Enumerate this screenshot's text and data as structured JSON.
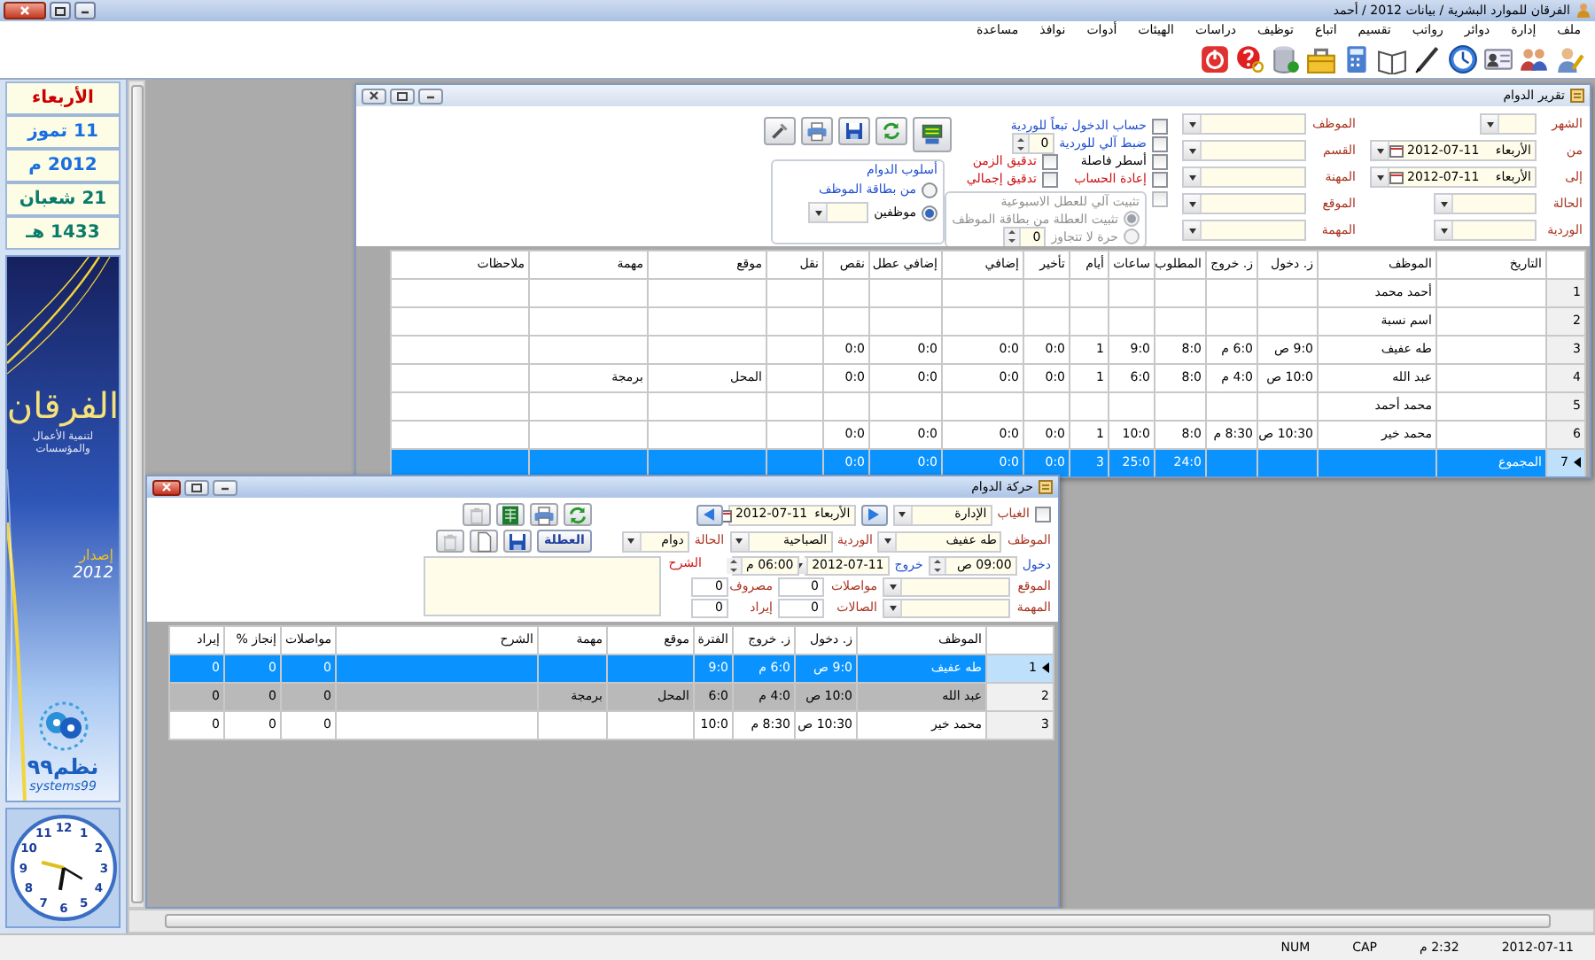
{
  "window": {
    "title": "الفرقان للموارد البشرية / بيانات 2012 / أحمد"
  },
  "menu": [
    {
      "label": "ملف"
    },
    {
      "label": "إدارة"
    },
    {
      "label": "دوائر"
    },
    {
      "label": "رواتب"
    },
    {
      "label": "تقسيم"
    },
    {
      "label": "اتباع"
    },
    {
      "label": "توظيف"
    },
    {
      "label": "دراسات"
    },
    {
      "label": "الهيئات"
    },
    {
      "label": "أدوات"
    },
    {
      "label": "نوافذ"
    },
    {
      "label": "مساعدة"
    }
  ],
  "sidebar": {
    "dates": [
      {
        "kind": "day",
        "text": "الأربعاء"
      },
      {
        "kind": "gregorian",
        "text": "11 تموز"
      },
      {
        "kind": "gregorian",
        "text": "2012 م"
      },
      {
        "kind": "hijri",
        "text": "21 شعبان"
      },
      {
        "kind": "hijri",
        "text": "1433 هـ"
      }
    ],
    "banner": {
      "title": "الفرقان",
      "subtitle": "لتنمية الأعمال والمؤسسات",
      "edition_label": "إصدار",
      "edition_year": "2012",
      "brand": "نظم٩٩",
      "brand_latin": "systems99"
    },
    "clock": {
      "numerals": [
        "12",
        "1",
        "11",
        "2",
        "10",
        "3",
        "9",
        "4",
        "8",
        "5",
        "7",
        "6"
      ]
    }
  },
  "report_window": {
    "title": "تقرير الدوام",
    "active": false,
    "period": [
      {
        "label": "الشهر",
        "kind": "dropdown"
      },
      {
        "label": "من",
        "kind": "date",
        "weekday": "الأربعاء",
        "date": "2012-07-11"
      },
      {
        "label": "إلى",
        "kind": "date",
        "weekday": "الأربعاء",
        "date": "2012-07-11"
      },
      {
        "label": "الحالة",
        "kind": "dropdown"
      },
      {
        "label": "الوردية",
        "kind": "dropdown"
      }
    ],
    "filters": [
      {
        "label": "الموظف"
      },
      {
        "label": "القسم"
      },
      {
        "label": "المهنة"
      },
      {
        "label": "الموقع"
      },
      {
        "label": "المهمة"
      }
    ],
    "options": [
      {
        "label": "حساب الدخول تبعاً للوردية",
        "checked": false,
        "color": "#1f4fd0"
      },
      {
        "label": "ضبط آلي للوردية",
        "checked": false,
        "color": "#1f4fd0",
        "spinner": "0"
      },
      {
        "label": "أسطر فاصلة",
        "checked": false,
        "color": "#000000"
      },
      {
        "label": "إعادة الحساب",
        "checked": false,
        "color": "#d01010"
      }
    ],
    "audits": [
      {
        "label": "تدقيق الزمن",
        "checked": false
      },
      {
        "label": "تدقيق إجمالي",
        "checked": false
      }
    ],
    "weekend": {
      "label": "تثبيت آلي للعطل الاسبوعية",
      "checked": false,
      "disabled": true,
      "choices": [
        {
          "label": "تثبيت العطلة من بطاقة الموظف",
          "selected": true
        },
        {
          "label": "حرة لا تتجاوز",
          "selected": false,
          "spinner": "0"
        }
      ]
    },
    "attendance_mode": {
      "title": "أسلوب الدوام",
      "choices": [
        {
          "label": "من بطاقة الموظف",
          "selected": false
        },
        {
          "label": "موظفين",
          "selected": true
        }
      ]
    },
    "table": {
      "columns": [
        "التاريخ",
        "الموظف",
        "ز. دخول",
        "ز. خروج",
        "المطلوب",
        "ساعات",
        "أيام",
        "تأخير",
        "إضافي",
        "إضافي عطل",
        "نقص",
        "نقل",
        "موقع",
        "مهمة",
        "ملاحظات"
      ],
      "rows": [
        {
          "number": "1",
          "selected": false,
          "employee": "أحمد محمد"
        },
        {
          "number": "2",
          "selected": false,
          "employee": "اسم نسبة"
        },
        {
          "number": "3",
          "selected": false,
          "employee": "طه عفيف",
          "in": "9:0 ص",
          "out": "6:0 م",
          "required": "8:0",
          "hours": "9:0",
          "days": "1",
          "late": "0:0",
          "overtime": "0:0",
          "holiday_overtime": "0:0",
          "shortfall": "0:0"
        },
        {
          "number": "4",
          "selected": false,
          "employee": "عبد الله",
          "in": "10:0 ص",
          "out": "4:0 م",
          "required": "8:0",
          "hours": "6:0",
          "days": "1",
          "late": "0:0",
          "overtime": "0:0",
          "holiday_overtime": "0:0",
          "shortfall": "0:0",
          "site": "المحل",
          "task": "برمجة"
        },
        {
          "number": "5",
          "selected": false,
          "employee": "محمد أحمد"
        },
        {
          "number": "6",
          "selected": false,
          "employee": "محمد خير",
          "in": "10:30 ص",
          "out": "8:30 م",
          "required": "8:0",
          "hours": "10:0",
          "days": "1",
          "late": "0:0",
          "overtime": "0:0",
          "holiday_overtime": "0:0",
          "shortfall": "0:0"
        },
        {
          "number": "7",
          "selected": true,
          "date": "المجموع",
          "required": "24:0",
          "hours": "25:0",
          "days": "3",
          "late": "0:0",
          "overtime": "0:0",
          "holiday_overtime": "0:0",
          "shortfall": "0:0"
        }
      ]
    }
  },
  "movement_window": {
    "title": "حركة الدوام",
    "active": true,
    "absence": {
      "label": "الغياب",
      "checked": false
    },
    "department": "الإدارة",
    "date": {
      "weekday": "الأربعاء",
      "date": "2012-07-11"
    },
    "employee": {
      "label": "الموظف",
      "value": "طه عفيف"
    },
    "shift": {
      "label": "الوردية",
      "value": "الصباحية"
    },
    "status": {
      "label": "الحالة",
      "value": "دوام"
    },
    "holiday_button": "العطلة",
    "entry": {
      "label": "دخول",
      "time": "09:00 ص"
    },
    "exit": {
      "label": "خروج",
      "date": "2012-07-11",
      "time": "06:00 م"
    },
    "description": {
      "label": "الشرح"
    },
    "site": {
      "label": "الموقع"
    },
    "task": {
      "label": "المهمة"
    },
    "amounts": [
      {
        "label": "مواصلات",
        "value": "0"
      },
      {
        "label": "مصروف",
        "value": "0"
      },
      {
        "label": "الصالات",
        "value": "0"
      },
      {
        "label": "إيراد",
        "value": "0"
      }
    ],
    "table": {
      "columns": [
        "الموظف",
        "ز. دخول",
        "ز. خروج",
        "الفترة",
        "موقع",
        "مهمة",
        "الشرح",
        "مواصلات",
        "إنجاز %",
        "إيراد"
      ],
      "rows": [
        {
          "number": "1",
          "selected": true,
          "highlighted": false,
          "employee": "طه عفيف",
          "in": "9:0 ص",
          "out": "6:0 م",
          "period": "9:0",
          "transport": "0",
          "completion": "0",
          "revenue": "0"
        },
        {
          "number": "2",
          "selected": false,
          "highlighted": true,
          "employee": "عبد الله",
          "in": "10:0 ص",
          "out": "4:0 م",
          "period": "6:0",
          "site": "المحل",
          "task": "برمجة",
          "transport": "0",
          "completion": "0",
          "revenue": "0"
        },
        {
          "number": "3",
          "selected": false,
          "highlighted": false,
          "employee": "محمد خير",
          "in": "10:30 ص",
          "out": "8:30 م",
          "period": "10:0",
          "transport": "0",
          "completion": "0",
          "revenue": "0"
        }
      ]
    }
  },
  "status_bar": [
    {
      "text": "2012-07-11"
    },
    {
      "text": "2:32 م"
    },
    {
      "text": "CAP"
    },
    {
      "text": "NUM"
    }
  ]
}
